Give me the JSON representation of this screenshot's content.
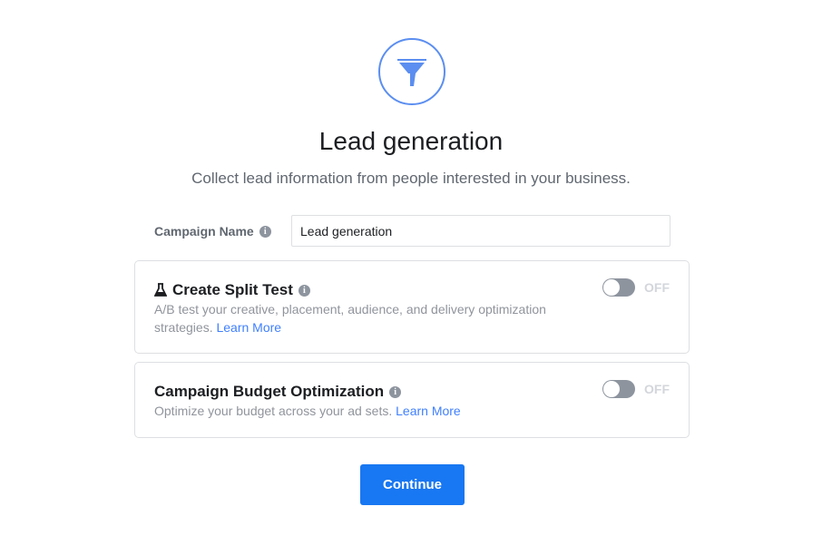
{
  "header": {
    "icon": "funnel-icon",
    "accent_color": "#5b8ef0",
    "title": "Lead generation",
    "subtitle": "Collect lead information from people interested in your business."
  },
  "campaign_name": {
    "label": "Campaign Name",
    "info_icon": "i",
    "value": "Lead generation"
  },
  "split_test": {
    "icon": "flask-icon",
    "title": "Create Split Test",
    "info_icon": "i",
    "description": "A/B test your creative, placement, audience, and delivery optimization strategies.",
    "learn_more": "Learn More",
    "toggle_state": "OFF"
  },
  "budget_optimization": {
    "title": "Campaign Budget Optimization",
    "info_icon": "i",
    "description": "Optimize your budget across your ad sets.",
    "learn_more": "Learn More",
    "toggle_state": "OFF"
  },
  "continue_button": {
    "label": "Continue",
    "color": "#1877f2"
  }
}
